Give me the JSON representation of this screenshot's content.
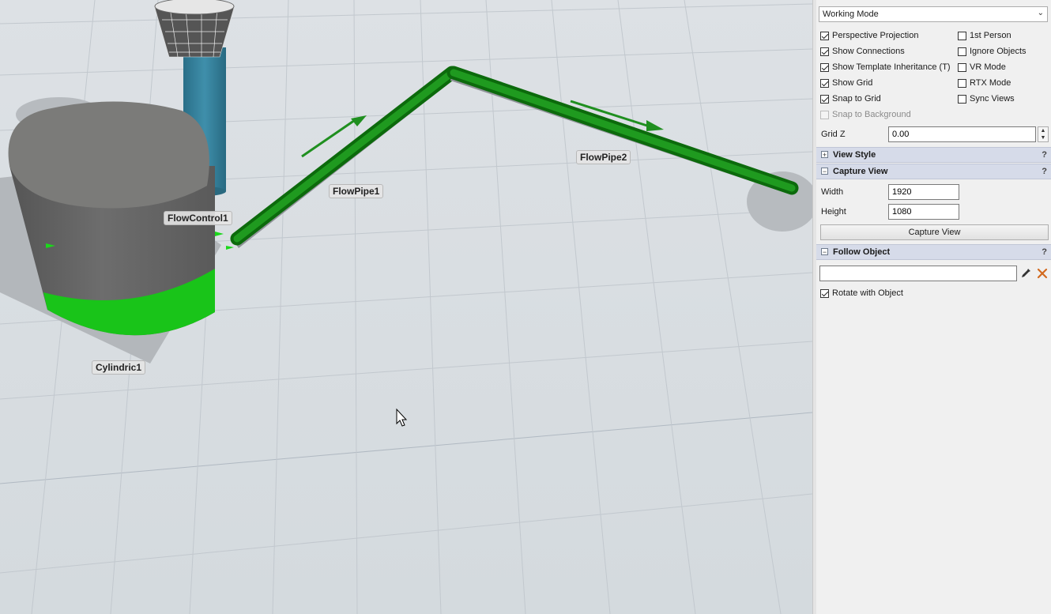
{
  "viewport": {
    "labels": {
      "flowpipe1": "FlowPipe1",
      "flowpipe2": "FlowPipe2",
      "flowcontrol1": "FlowControl1",
      "cylindric1": "Cylindric1"
    }
  },
  "panel": {
    "mode_dropdown": "Working Mode",
    "checkboxes_left": [
      {
        "label": "Perspective Projection",
        "checked": true
      },
      {
        "label": "Show Connections",
        "checked": true
      },
      {
        "label": "Show Template Inheritance (T)",
        "checked": true
      },
      {
        "label": "Show Grid",
        "checked": true
      },
      {
        "label": "Snap to Grid",
        "checked": true
      },
      {
        "label": "Snap to Background",
        "checked": false,
        "disabled": true
      }
    ],
    "checkboxes_right": [
      {
        "label": "1st Person",
        "checked": false
      },
      {
        "label": "Ignore Objects",
        "checked": false
      },
      {
        "label": "VR Mode",
        "checked": false
      },
      {
        "label": "RTX Mode",
        "checked": false
      },
      {
        "label": "Sync Views",
        "checked": false
      }
    ],
    "grid_z": {
      "label": "Grid Z",
      "value": "0.00"
    },
    "sections": {
      "view_style": {
        "title": "View Style",
        "toggle": "+",
        "help": "?"
      },
      "capture_view": {
        "title": "Capture View",
        "toggle": "−",
        "help": "?"
      },
      "follow_object": {
        "title": "Follow Object",
        "toggle": "−",
        "help": "?"
      }
    },
    "capture": {
      "width_label": "Width",
      "width_value": "1920",
      "height_label": "Height",
      "height_value": "1080",
      "button_label": "Capture View"
    },
    "follow": {
      "object_value": "",
      "rotate_label": "Rotate with Object",
      "rotate_checked": true
    }
  }
}
